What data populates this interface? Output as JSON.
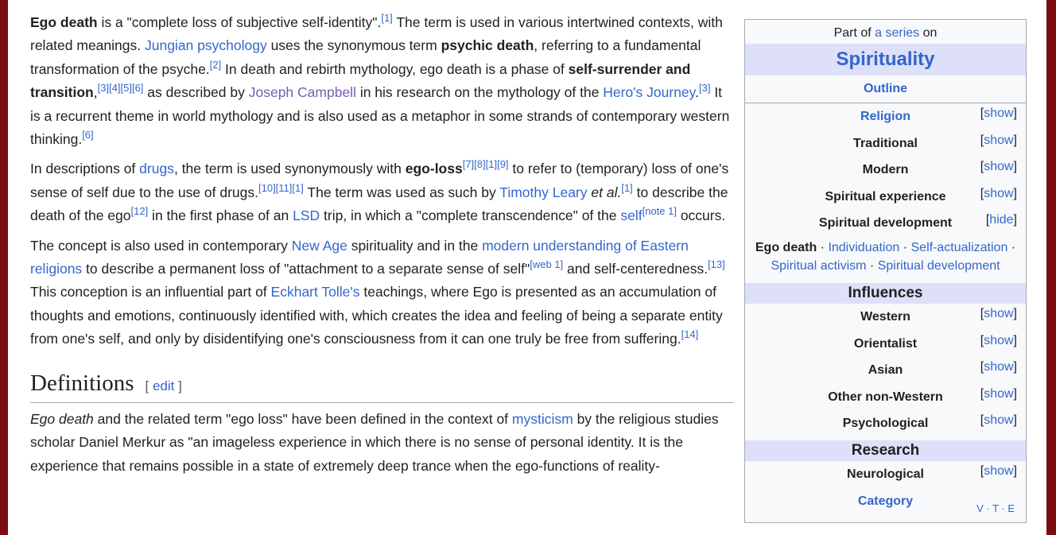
{
  "p1": {
    "b1": "Ego death",
    "t1": " is a \"complete loss of subjective self-identity\".",
    "r1": "[1]",
    "t2": " The term is used in various intertwined contexts, with related meanings. ",
    "l1": "Jungian psychology",
    "t3": " uses the synonymous term ",
    "b2": "psychic death",
    "t4": ", referring to a fundamental transformation of the psyche.",
    "r2": "[2]",
    "t5": " In death and rebirth mythology, ego death is a phase of ",
    "b3": "self-surrender and transition",
    "t6": ",",
    "r3": "[3][4][5][6]",
    "t7": " as described by ",
    "l2": "Joseph Campbell",
    "t8": " in his research on the mythology of the ",
    "l3": "Hero's Journey",
    "t9": ".",
    "r4": "[3]",
    "t10": " It is a recurrent theme in world mythology and is also used as a metaphor in some strands of contemporary western thinking.",
    "r5": "[6]"
  },
  "p2": {
    "t1": "In descriptions of ",
    "l1": "drugs",
    "t2": ", the term is used synonymously with ",
    "b1": "ego-loss",
    "r1": "[7][8][1][9]",
    "t3": " to refer to (temporary) loss of one's sense of self due to the use of drugs.",
    "r2": "[10][11][1]",
    "t4": " The term was used as such by ",
    "l2": "Timothy Leary",
    "i1": " et al.",
    "r3": "[1]",
    "t5": " to describe the death of the ego",
    "r4": "[12]",
    "t6": " in the first phase of an ",
    "l3": "LSD",
    "t7": " trip, in which a \"complete transcendence\" of the ",
    "l4": "self",
    "r5": "[note 1]",
    "t8": " occurs."
  },
  "p3": {
    "t1": "The concept is also used in contemporary ",
    "l1": "New Age",
    "t2": " spirituality and in the ",
    "l2": "modern understanding of Eastern religions",
    "t3": " to describe a permanent loss of \"attachment to a separate sense of self\"",
    "r1": "[web 1]",
    "t4": " and self-centeredness.",
    "r2": "[13]",
    "t5": " This conception is an influential part of ",
    "l3": "Eckhart Tolle's",
    "t6": " teachings, where Ego is presented as an accumulation of thoughts and emotions, continuously identified with, which creates the idea and feeling of being a separate entity from one's self, and only by disidentifying one's consciousness from it can one truly be free from suffering.",
    "r3": "[14]"
  },
  "section": {
    "title": "Definitions",
    "edit_open": "[ ",
    "edit": "edit",
    "edit_close": " ]"
  },
  "p4": {
    "i1": "Ego death",
    "t1": " and the related term \"ego loss\" have been defined in the context of ",
    "l1": "mysticism",
    "t2": " by the religious studies scholar Daniel Merkur as \"an imageless experience in which there is no sense of personal identity. It is the experience that remains possible in a state of extremely deep trance when the ego-functions of reality-"
  },
  "sidebar": {
    "part_of": "Part of ",
    "a_series": "a series",
    "on": " on",
    "title": "Spirituality",
    "outline": "Outline",
    "rows1": [
      {
        "label": "Religion",
        "toggle": "[show]",
        "link": true
      },
      {
        "label": "Traditional",
        "toggle": "[show]"
      },
      {
        "label": "Modern",
        "toggle": "[show]"
      },
      {
        "label": "Spiritual experience",
        "toggle": "[show]"
      },
      {
        "label": "Spiritual development",
        "toggle": "[hide]"
      }
    ],
    "dev_list": {
      "ego": "Ego death",
      "sep": " · ",
      "individuation": "Individuation",
      "self_act": "Self-actualization",
      "activism": "Spiritual activism",
      "spiritual_dev": "Spiritual development"
    },
    "influences": "Influences",
    "rows2": [
      {
        "label": "Western",
        "toggle": "[show]"
      },
      {
        "label": "Orientalist",
        "toggle": "[show]"
      },
      {
        "label": "Asian",
        "toggle": "[show]"
      },
      {
        "label": "Other non-Western",
        "toggle": "[show]"
      },
      {
        "label": "Psychological",
        "toggle": "[show]"
      }
    ],
    "research": "Research",
    "rows3": [
      {
        "label": "Neurological",
        "toggle": "[show]"
      }
    ],
    "category": "Category",
    "vte": "V · T · E"
  }
}
